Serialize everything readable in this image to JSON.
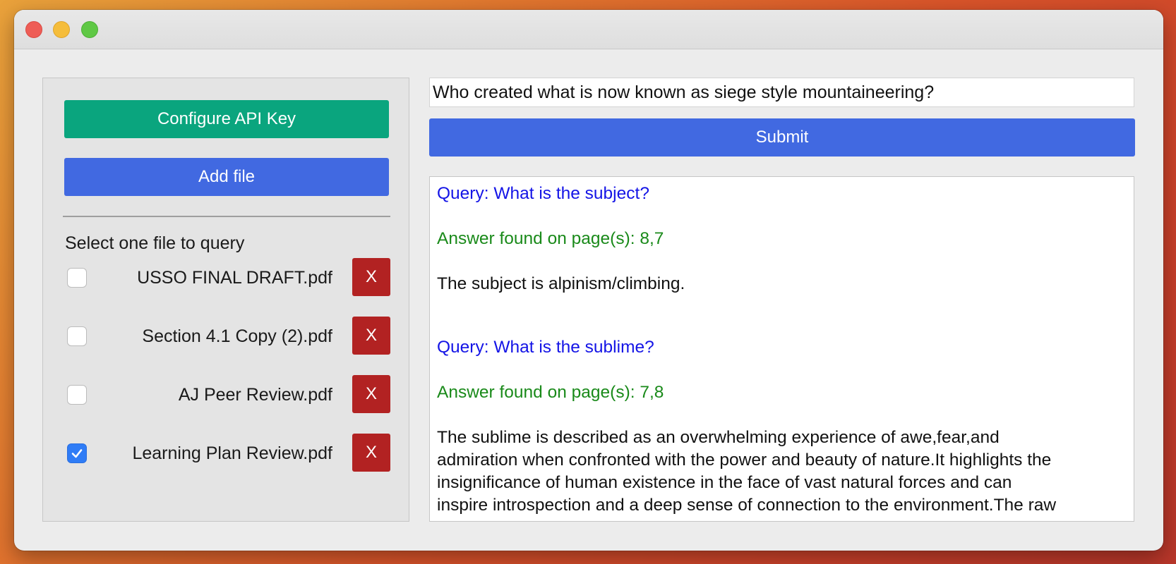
{
  "window": {
    "traffic_lights": [
      "close",
      "minimize",
      "maximize"
    ]
  },
  "sidebar": {
    "configure_label": "Configure API Key",
    "add_file_label": "Add file",
    "select_label": "Select one file to query",
    "remove_label": "X",
    "files": [
      {
        "name": "USSO FINAL DRAFT.pdf",
        "checked": false
      },
      {
        "name": "Section 4.1 Copy (2).pdf",
        "checked": false
      },
      {
        "name": "AJ Peer Review.pdf",
        "checked": false
      },
      {
        "name": "Learning Plan Review.pdf",
        "checked": true
      }
    ]
  },
  "query": {
    "value": "Who created what is now known as siege style mountaineering?",
    "submit_label": "Submit"
  },
  "results": [
    {
      "query": "Query: What is the subject?",
      "pages": "Answer found on page(s): 8,7",
      "answer": "The subject is alpinism/climbing."
    },
    {
      "query": "Query: What is the sublime?",
      "pages": "Answer found on page(s): 7,8",
      "answer_lines": [
        "The sublime is described as an overwhelming experience of awe,fear,and",
        "admiration when confronted with the power and beauty of nature.It highlights the",
        "insignificance of human existence in the face of vast natural forces and can",
        "inspire introspection and a deep sense of connection to the environment.The raw"
      ]
    }
  ],
  "colors": {
    "config_button": "#0aa57e",
    "primary_button": "#4169e1",
    "remove_button": "#b22222",
    "query_text": "#1414e6",
    "answer_meta_text": "#1a8a1a",
    "checkbox_checked": "#2f7cf6"
  }
}
